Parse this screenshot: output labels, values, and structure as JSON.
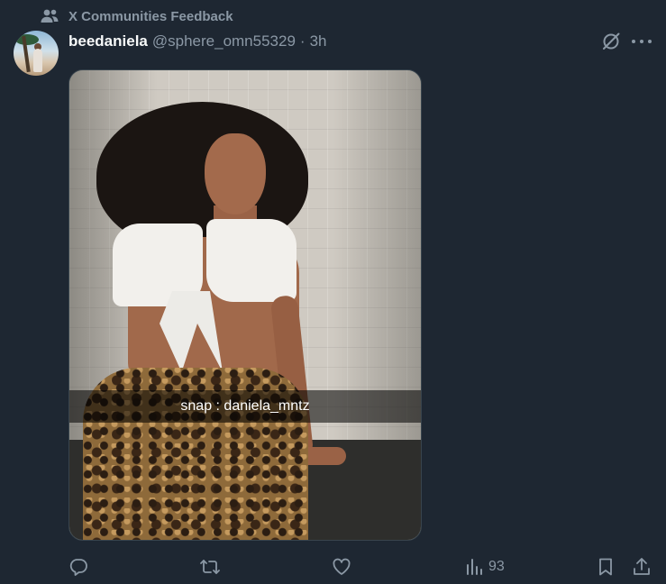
{
  "community": {
    "label": "X Communities Feedback",
    "icon": "people-icon"
  },
  "post": {
    "display_name": "beedaniela",
    "handle": "@sphere_omn55329",
    "separator": "·",
    "time": "3h",
    "media_caption": "snap : daniela_mntz"
  },
  "actions": {
    "reply": {
      "icon": "reply-icon",
      "count": ""
    },
    "repost": {
      "icon": "repost-icon",
      "count": ""
    },
    "like": {
      "icon": "heart-icon",
      "count": ""
    },
    "views": {
      "icon": "views-icon",
      "count": "93"
    },
    "bookmark": {
      "icon": "bookmark-icon"
    },
    "share": {
      "icon": "share-icon"
    }
  },
  "colors": {
    "background": "#1e2732",
    "primary_text": "#f7f9f9",
    "secondary_text": "#8b98a5"
  }
}
